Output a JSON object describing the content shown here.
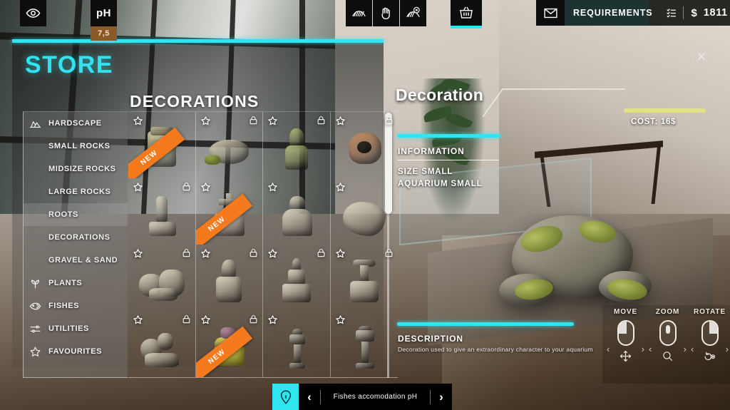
{
  "topbar": {
    "eye_icon": "eye-icon",
    "ph_label": "pH",
    "ph_value": "7,5",
    "terrain_icon": "terrain-brush-icon",
    "hand_icon": "hand-icon",
    "terrain_delete_icon": "terrain-delete-icon",
    "basket_icon": "shopping-basket-icon",
    "mail_icon": "mail-icon",
    "requirements_label": "REQUIREMENTS",
    "checklist_icon": "checklist-icon",
    "currency_symbol": "$",
    "money": "1811"
  },
  "store": {
    "title": "STORE",
    "close_label": "✕",
    "category_title": "DECORATIONS",
    "categories": [
      {
        "label": "HARDSCAPE",
        "icon": "rocks-icon",
        "sub": false,
        "selected": false
      },
      {
        "label": "SMALL ROCKS",
        "icon": "",
        "sub": true,
        "selected": false
      },
      {
        "label": "MIDSIZE ROCKS",
        "icon": "",
        "sub": true,
        "selected": false
      },
      {
        "label": "LARGE ROCKS",
        "icon": "",
        "sub": true,
        "selected": false
      },
      {
        "label": "ROOTS",
        "icon": "",
        "sub": true,
        "selected": true
      },
      {
        "label": "DECORATIONS",
        "icon": "",
        "sub": true,
        "selected": false
      },
      {
        "label": "GRAVEL & SAND",
        "icon": "",
        "sub": true,
        "selected": false
      },
      {
        "label": "PLANTS",
        "icon": "plant-icon",
        "sub": false,
        "selected": false
      },
      {
        "label": "FISHES",
        "icon": "fish-icon",
        "sub": false,
        "selected": false
      },
      {
        "label": "UTILITIES",
        "icon": "sliders-icon",
        "sub": false,
        "selected": false
      },
      {
        "label": "FAVOURITES",
        "icon": "star-icon",
        "sub": false,
        "selected": false
      }
    ],
    "new_badge_label": "NEW",
    "items": [
      {
        "name": "carved-totem-block",
        "locked": false,
        "new": true,
        "kind": "block",
        "tint": "#cfc79d"
      },
      {
        "name": "mossy-shell-rock",
        "locked": true,
        "new": false,
        "kind": "shell",
        "tint": "#d8d3b6"
      },
      {
        "name": "green-statue",
        "locked": true,
        "new": false,
        "kind": "statue",
        "tint": "#b6bf7e"
      },
      {
        "name": "diving-helmet",
        "locked": true,
        "new": false,
        "kind": "helmet",
        "tint": "#c98f63"
      },
      {
        "name": "small-ruin-column",
        "locked": true,
        "new": false,
        "kind": "column",
        "tint": "#ded8c4"
      },
      {
        "name": "stone-cross-monument",
        "locked": false,
        "new": true,
        "kind": "cross",
        "tint": "#e2dcc8"
      },
      {
        "name": "seated-figure-statue",
        "locked": false,
        "new": false,
        "kind": "figure",
        "tint": "#e0d9c3"
      },
      {
        "name": "coral-rock-formation",
        "locked": false,
        "new": false,
        "kind": "rock",
        "tint": "#ded7c0"
      },
      {
        "name": "ruin-arch-pile",
        "locked": true,
        "new": false,
        "kind": "pile",
        "tint": "#ddd6bf"
      },
      {
        "name": "ornate-temple-pillar",
        "locked": true,
        "new": false,
        "kind": "pillar",
        "tint": "#ddd6bf"
      },
      {
        "name": "tall-ruin-tower",
        "locked": true,
        "new": false,
        "kind": "tower",
        "tint": "#ded7c1"
      },
      {
        "name": "ornate-spire",
        "locked": true,
        "new": false,
        "kind": "spire",
        "tint": "#ded7c1"
      },
      {
        "name": "rock-garden-cluster",
        "locked": true,
        "new": false,
        "kind": "cluster",
        "tint": "#dcd5be"
      },
      {
        "name": "treasure-chest",
        "locked": true,
        "new": true,
        "kind": "chest",
        "tint": "#c9c05e"
      },
      {
        "name": "stone-lantern",
        "locked": false,
        "new": false,
        "kind": "lantern",
        "tint": "#cfc9bb"
      },
      {
        "name": "tall-stone-lantern",
        "locked": false,
        "new": false,
        "kind": "lantern2",
        "tint": "#cfc9bb"
      }
    ]
  },
  "detail": {
    "title": "Decoration",
    "cost_label": "COST: 16$",
    "information_heading": "INFORMATION",
    "size_line": "SIZE  SMALL",
    "aquarium_line": "AQUARIUM  SMALL",
    "description_heading": "DESCRIPTION",
    "description_body": "Decoration used to give an extraordinary character to your aquarium"
  },
  "controls": [
    {
      "label": "MOVE",
      "glyph": "move-arrows-icon"
    },
    {
      "label": "ZOOM",
      "glyph": "magnifier-icon"
    },
    {
      "label": "ROTATE",
      "glyph": "rotate-icon"
    }
  ],
  "tipbar": {
    "info_icon": "info-pin-icon",
    "prev_label": "‹",
    "next_label": "›",
    "text": "Fishes accomodation pH"
  },
  "colors": {
    "accent_cyan": "#2ee6f0",
    "new_orange": "#f47a1d",
    "cost_yellow": "#e4e089",
    "ph_brown": "#8a5a28"
  }
}
